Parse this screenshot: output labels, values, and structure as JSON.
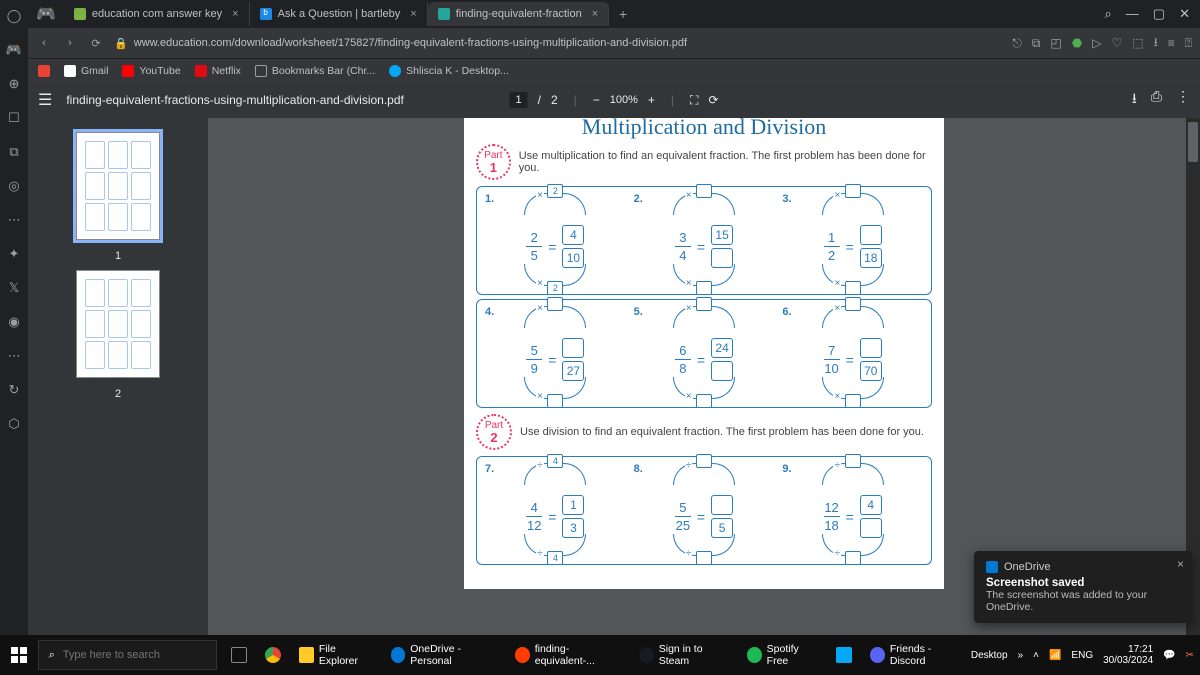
{
  "tabs": [
    {
      "label": "education com answer key"
    },
    {
      "label": "Ask a Question | bartleby"
    },
    {
      "label": "finding-equivalent-fraction"
    }
  ],
  "omnibox": {
    "url": "www.education.com/download/worksheet/175827/finding-equivalent-fractions-using-multiplication-and-division.pdf"
  },
  "bookmarks": [
    {
      "label": "Gmail"
    },
    {
      "label": "YouTube"
    },
    {
      "label": "Netflix"
    },
    {
      "label": "Bookmarks Bar (Chr..."
    },
    {
      "label": "Shliscia K - Desktop..."
    }
  ],
  "pdf": {
    "filename": "finding-equivalent-fractions-using-multiplication-and-division.pdf",
    "page_current": "1",
    "page_total": "2",
    "page_sep": "/",
    "zoom": "100%",
    "thumbs": [
      "1",
      "2"
    ]
  },
  "worksheet": {
    "title": "Multiplication and Division",
    "part1": {
      "badge_top": "Part",
      "badge_num": "1",
      "instr": "Use multiplication to find an equivalent fraction. The first problem has been done for you."
    },
    "part2": {
      "badge_top": "Part",
      "badge_num": "2",
      "instr": "Use division to find an equivalent fraction. The first problem has been done for you."
    },
    "p": {
      "1": {
        "num": "1.",
        "op": "×",
        "tv": "2",
        "bv": "2",
        "ln": "2",
        "ld": "5",
        "rn": "4",
        "rd": "10"
      },
      "2": {
        "num": "2.",
        "op": "×",
        "tv": "",
        "bv": "",
        "ln": "3",
        "ld": "4",
        "rn": "15",
        "rd": ""
      },
      "3": {
        "num": "3.",
        "op": "×",
        "tv": "",
        "bv": "",
        "ln": "1",
        "ld": "2",
        "rn": "",
        "rd": "18"
      },
      "4": {
        "num": "4.",
        "op": "×",
        "tv": "",
        "bv": "",
        "ln": "5",
        "ld": "9",
        "rn": "",
        "rd": "27"
      },
      "5": {
        "num": "5.",
        "op": "×",
        "tv": "",
        "bv": "",
        "ln": "6",
        "ld": "8",
        "rn": "24",
        "rd": ""
      },
      "6": {
        "num": "6.",
        "op": "×",
        "tv": "",
        "bv": "",
        "ln": "7",
        "ld": "10",
        "rn": "",
        "rd": "70"
      },
      "7": {
        "num": "7.",
        "op": "÷",
        "tv": "4",
        "bv": "4",
        "ln": "4",
        "ld": "12",
        "rn": "1",
        "rd": "3"
      },
      "8": {
        "num": "8.",
        "op": "÷",
        "tv": "",
        "bv": "",
        "ln": "5",
        "ld": "25",
        "rn": "",
        "rd": "5"
      },
      "9": {
        "num": "9.",
        "op": "÷",
        "tv": "",
        "bv": "",
        "ln": "12",
        "ld": "18",
        "rn": "4",
        "rd": ""
      }
    }
  },
  "toast": {
    "app": "OneDrive",
    "title": "Screenshot saved",
    "body": "The screenshot was added to your OneDrive."
  },
  "taskbar": {
    "search_placeholder": "Type here to search",
    "items": [
      {
        "label": "File Explorer"
      },
      {
        "label": "OneDrive - Personal"
      },
      {
        "label": "finding-equivalent-..."
      },
      {
        "label": "Sign in to Steam"
      },
      {
        "label": "Spotify Free"
      },
      {
        "label": "Friends - Discord"
      }
    ],
    "tray": {
      "desktop": "Desktop",
      "lang": "ENG",
      "time": "17:21",
      "date": "30/03/2024"
    }
  }
}
